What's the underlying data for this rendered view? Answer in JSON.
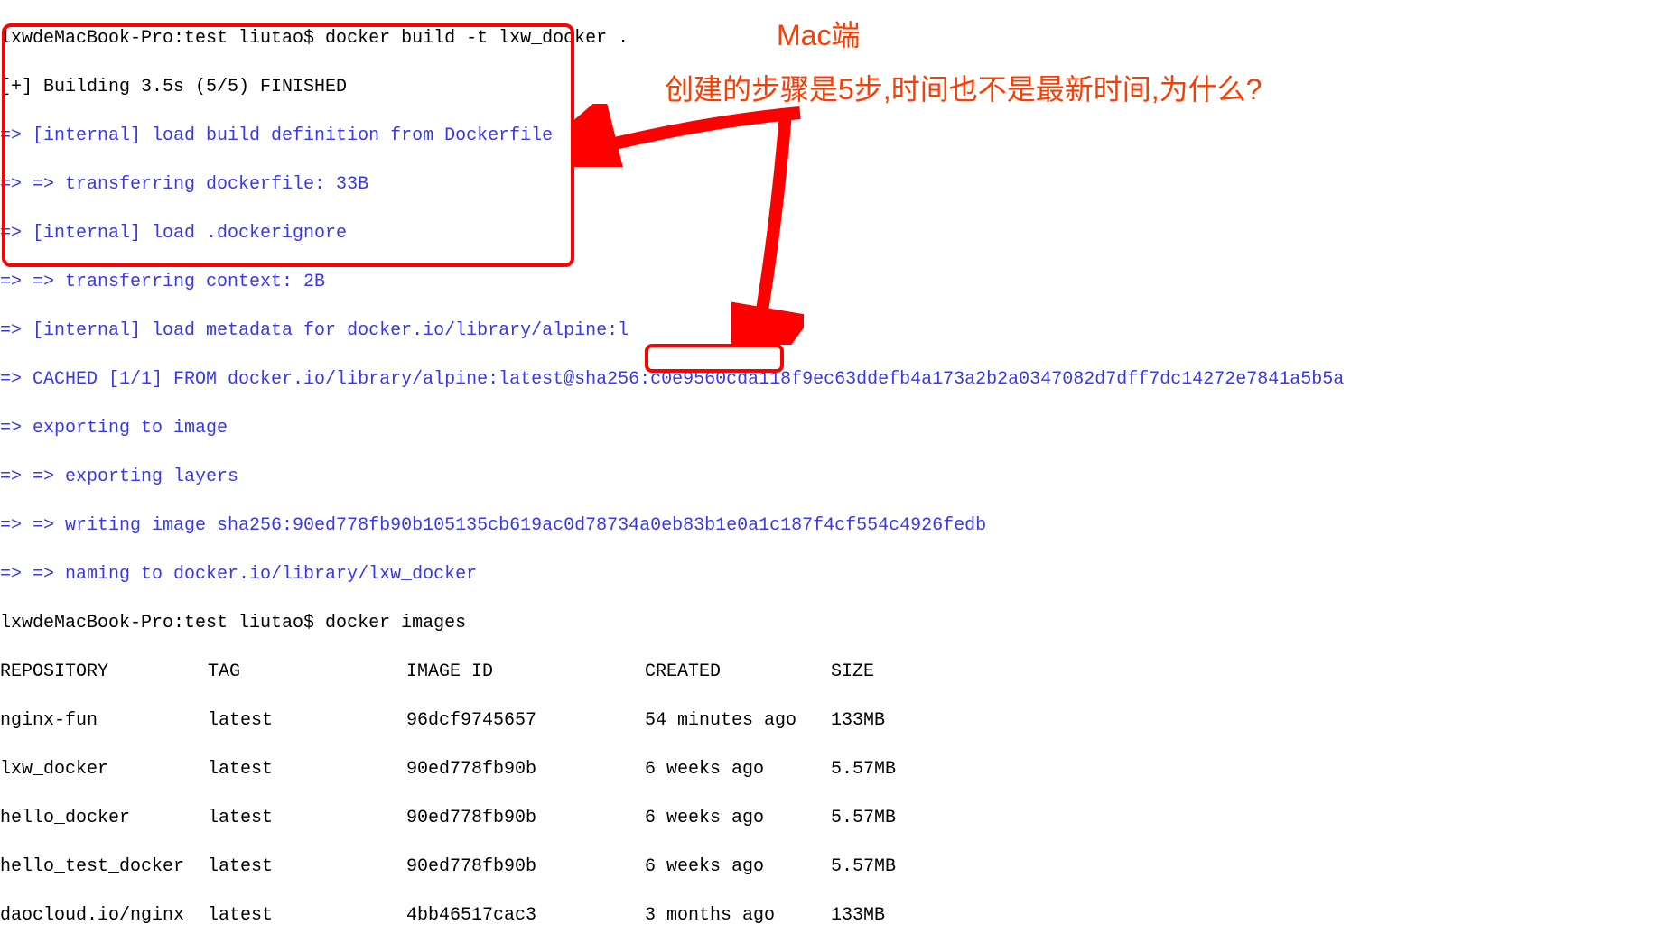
{
  "prompt1": "lxwdeMacBook-Pro:test liutao$ docker build -t lxw_docker .",
  "build_header": "[+] Building 3.5s (5/5) FINISHED",
  "build_lines": [
    "=> [internal] load build definition from Dockerfile",
    "=> => transferring dockerfile: 33B",
    "=> [internal] load .dockerignore",
    "=> => transferring context: 2B",
    "=> [internal] load metadata for docker.io/library/alpine:l",
    "=> CACHED [1/1] FROM docker.io/library/alpine:latest@sha256:c0e9560cda118f9ec63ddefb4a173a2b2a0347082d7dff7dc14272e7841a5b5a",
    "=> exporting to image",
    "=> => exporting layers",
    "=> => writing image sha256:90ed778fb90b105135cb619ac0d78734a0eb83b1e0a1c187f4cf554c4926fedb",
    "=> => naming to docker.io/library/lxw_docker"
  ],
  "prompt2": "lxwdeMacBook-Pro:test liutao$ docker images",
  "table": {
    "headers": {
      "repo": "REPOSITORY",
      "tag": "TAG",
      "imageid": "IMAGE ID",
      "created": "CREATED",
      "size": "SIZE"
    },
    "rows": [
      {
        "repo": "nginx-fun",
        "tag": "latest",
        "imageid": "96dcf9745657",
        "created": "54 minutes ago",
        "size": "133MB"
      },
      {
        "repo": "lxw_docker",
        "tag": "latest",
        "imageid": "90ed778fb90b",
        "created": "6 weeks ago",
        "size": "5.57MB"
      },
      {
        "repo": "hello_docker",
        "tag": "latest",
        "imageid": "90ed778fb90b",
        "created": "6 weeks ago",
        "size": "5.57MB"
      },
      {
        "repo": "hello_test_docker",
        "tag": "latest",
        "imageid": "90ed778fb90b",
        "created": "6 weeks ago",
        "size": "5.57MB"
      },
      {
        "repo": "daocloud.io/nginx",
        "tag": "latest",
        "imageid": "4bb46517cac3",
        "created": "3 months ago",
        "size": "133MB"
      }
    ]
  },
  "annotations": {
    "title": "Mac端",
    "question": "创建的步骤是5步,时间也不是最新时间,为什么?"
  }
}
